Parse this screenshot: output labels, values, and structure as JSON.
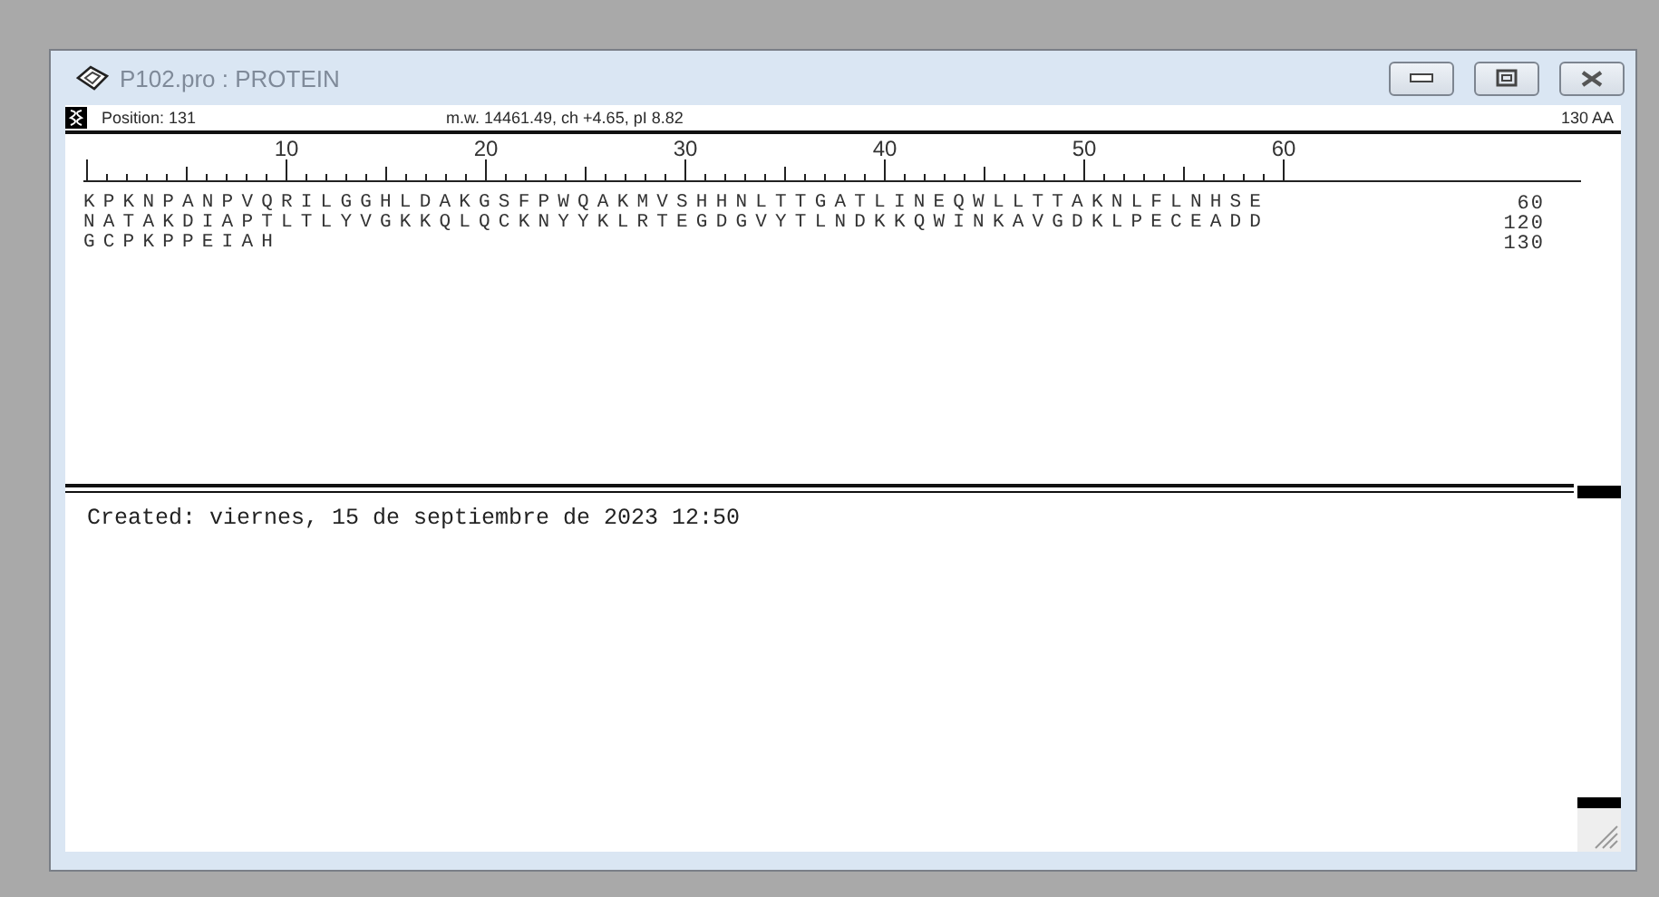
{
  "window": {
    "title": "P102.pro : PROTEIN"
  },
  "info_bar": {
    "position": "Position: 131",
    "stats": "m.w. 14461.49, ch +4.65, pI 8.82",
    "length": "130 AA"
  },
  "ruler": {
    "labels": [
      "10",
      "20",
      "30",
      "40",
      "50",
      "60"
    ]
  },
  "sequence": [
    {
      "residues": "KPKNPANPVQRILGGHLDAKGSFPWQAKMVSHHNLTTGATLINEQWLLTTAKNLFLNHSE",
      "end": "60"
    },
    {
      "residues": "NATAKDIAPTLTLYVGKKQLQCKNYYKLRTEGDGVYTLNDKKQWINKAVGDKLPECEADD",
      "end": "120"
    },
    {
      "residues": "GCPKPPEIAH",
      "end": "130"
    }
  ],
  "notes": {
    "text": "Created: viernes, 15 de septiembre de 2023 12:50"
  }
}
